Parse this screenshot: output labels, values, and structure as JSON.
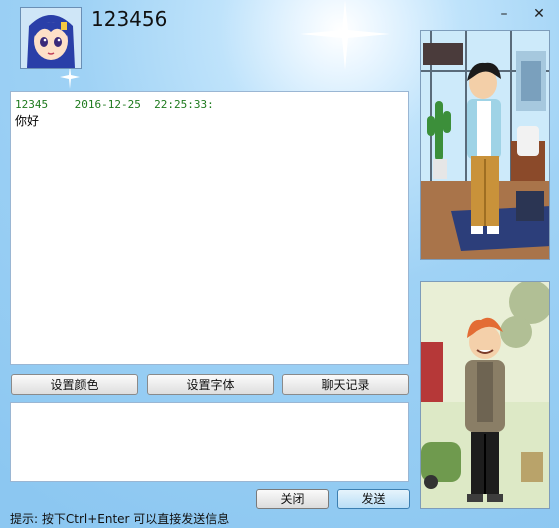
{
  "window": {
    "minimize_label": "–",
    "close_label": "✕"
  },
  "header": {
    "contact_name": "123456"
  },
  "chat": {
    "messages": [
      {
        "sender": "12345",
        "date": "2016-12-25",
        "time": "22:25:33:",
        "text": "你好"
      }
    ]
  },
  "toolbar": {
    "set_color_label": "设置颜色",
    "set_font_label": "设置字体",
    "chat_log_label": "聊天记录"
  },
  "footer": {
    "close_label": "关闭",
    "send_label": "发送",
    "hint_text": "提示: 按下Ctrl+Enter 可以直接发送信息"
  },
  "icons": {
    "avatar": "anime-girl-avatar",
    "show_top": "boy-in-office-show",
    "show_bottom": "boy-in-street-show"
  },
  "colors": {
    "message_header": "#1e7a1e",
    "background": "#9fd2f5"
  }
}
